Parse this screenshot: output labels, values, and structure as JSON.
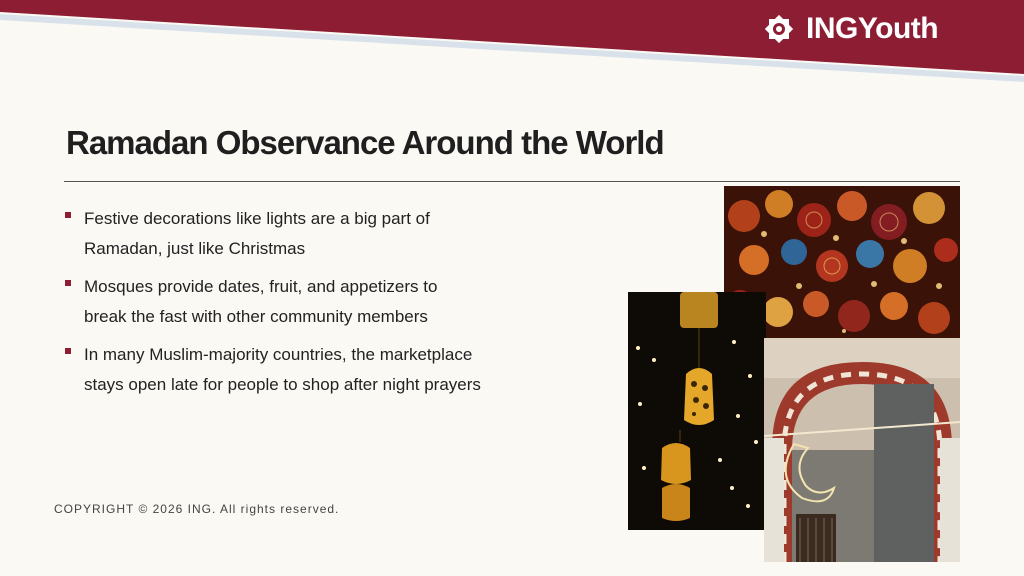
{
  "brand": {
    "name": "INGYouth",
    "color": "#8c1d33"
  },
  "slide": {
    "title": "Ramadan Observance Around the World",
    "bullets": [
      {
        "lines": [
          "Festive decorations like lights are a big part of",
          "Ramadan, just like Christmas"
        ]
      },
      {
        "lines": [
          "Mosques provide dates, fruit, and appetizers to",
          "break the fast with other community members"
        ]
      },
      {
        "lines": [
          "In many Muslim-majority countries, the marketplace",
          "stays open late for people to shop after night prayers"
        ]
      }
    ]
  },
  "footer": {
    "copyright": "COPYRIGHT © 2026 ING. All rights reserved."
  },
  "icons": [
    "ing-logo-icon",
    "bullet-square-icon"
  ],
  "photos": [
    "mosaic-lanterns-photo",
    "hanging-lanterns-photo",
    "mosque-arches-photo"
  ]
}
